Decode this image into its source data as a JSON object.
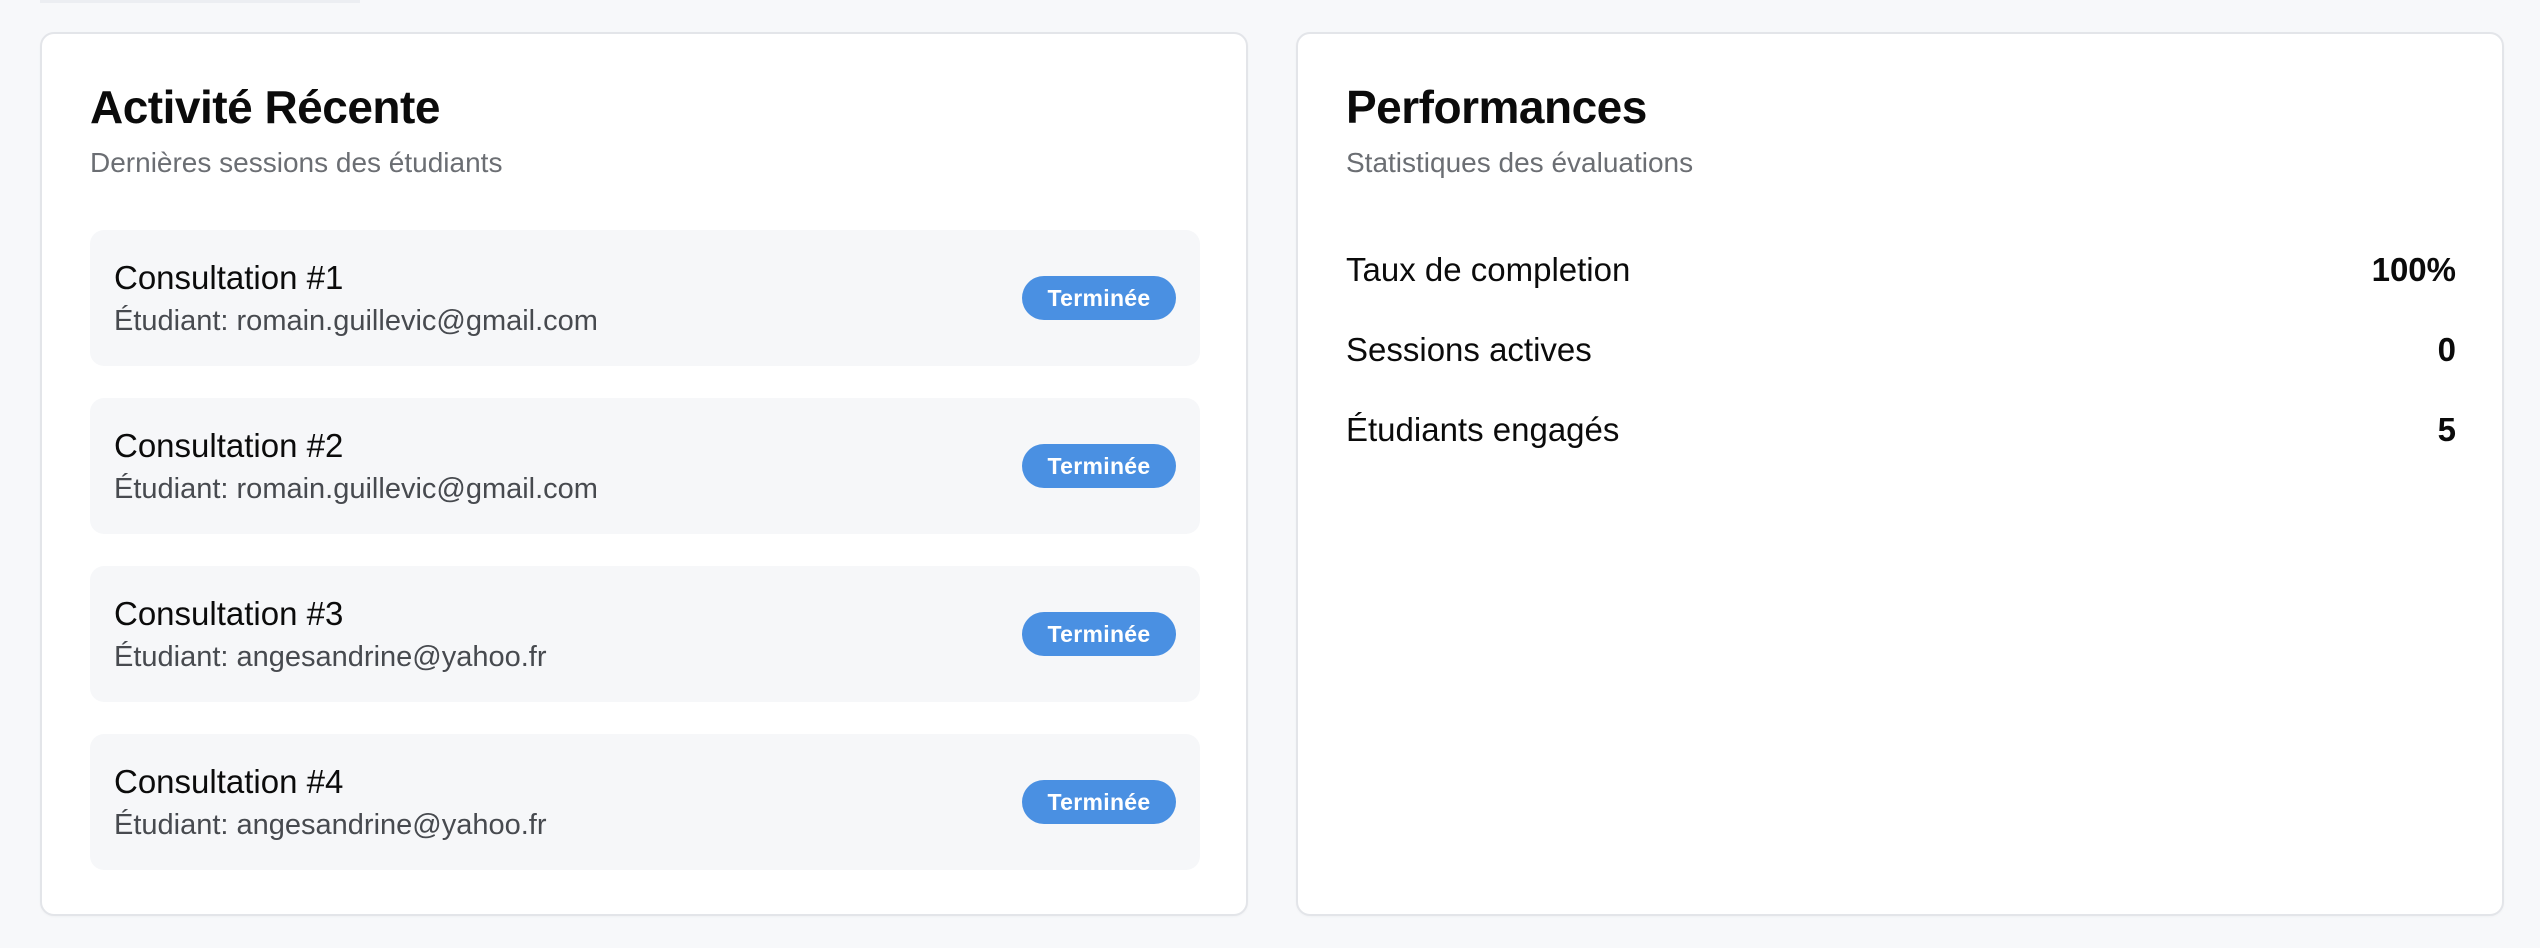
{
  "activity": {
    "title": "Activité Récente",
    "subtitle": "Dernières sessions des étudiants",
    "items": [
      {
        "title": "Consultation #1",
        "student": "Étudiant: romain.guillevic@gmail.com",
        "status": "Terminée"
      },
      {
        "title": "Consultation #2",
        "student": "Étudiant: romain.guillevic@gmail.com",
        "status": "Terminée"
      },
      {
        "title": "Consultation #3",
        "student": "Étudiant: angesandrine@yahoo.fr",
        "status": "Terminée"
      },
      {
        "title": "Consultation #4",
        "student": "Étudiant: angesandrine@yahoo.fr",
        "status": "Terminée"
      }
    ]
  },
  "performance": {
    "title": "Performances",
    "subtitle": "Statistiques des évaluations",
    "stats": [
      {
        "label": "Taux de completion",
        "value": "100%"
      },
      {
        "label": "Sessions actives",
        "value": "0"
      },
      {
        "label": "Étudiants engagés",
        "value": "5"
      }
    ]
  },
  "colors": {
    "background": "#f7f8fa",
    "card": "#ffffff",
    "item_background": "#f6f7f9",
    "badge": "#4a90e2",
    "muted_text": "#6b6e73"
  }
}
